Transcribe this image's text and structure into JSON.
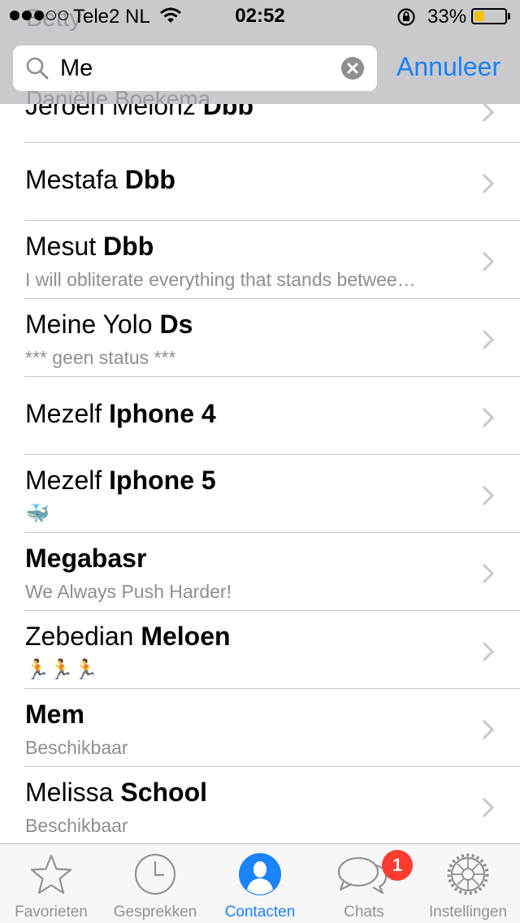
{
  "status_bar": {
    "carrier": "Tele2 NL",
    "time": "02:52",
    "battery_percent": "33%",
    "battery_level": 0.33,
    "signal_bars_filled": 3,
    "signal_bars_total": 5
  },
  "background_peek": {
    "top_name": "Betty",
    "second_name": "Daniëlle Boekema"
  },
  "search": {
    "query": "Me",
    "cancel_label": "Annuleer"
  },
  "contacts": [
    {
      "first": "Jeroen Melonz ",
      "bold": "Dbb",
      "status": ""
    },
    {
      "first": "Mestafa ",
      "bold": "Dbb",
      "status": ""
    },
    {
      "first": "Mesut ",
      "bold": "Dbb",
      "status": "I will obliterate everything that stands betwee…"
    },
    {
      "first": "Meine Yolo ",
      "bold": "Ds",
      "status": "*** geen status ***"
    },
    {
      "first": "Mezelf ",
      "bold": "Iphone 4",
      "status": ""
    },
    {
      "first": "Mezelf ",
      "bold": "Iphone 5",
      "status": "🐳"
    },
    {
      "first": "",
      "bold": "Megabasr",
      "status": "We Always Push Harder!"
    },
    {
      "first": "Zebedian ",
      "bold": "Meloen",
      "status": "🏃🏃🏃"
    },
    {
      "first": "",
      "bold": "Mem",
      "status": "Beschikbaar"
    },
    {
      "first": "Melissa ",
      "bold": "School",
      "status": "Beschikbaar"
    }
  ],
  "tabs": [
    {
      "label": "Favorieten",
      "icon": "star-icon"
    },
    {
      "label": "Gesprekken",
      "icon": "clock-icon"
    },
    {
      "label": "Contacten",
      "icon": "contacts-icon",
      "active": true
    },
    {
      "label": "Chats",
      "icon": "chat-bubbles-icon",
      "badge": "1"
    },
    {
      "label": "Instellingen",
      "icon": "gear-icon"
    }
  ],
  "colors": {
    "accent": "#1a82fb",
    "badge": "#ff3b30",
    "battery": "#f2c200",
    "secondary_text": "#8e8e93"
  }
}
